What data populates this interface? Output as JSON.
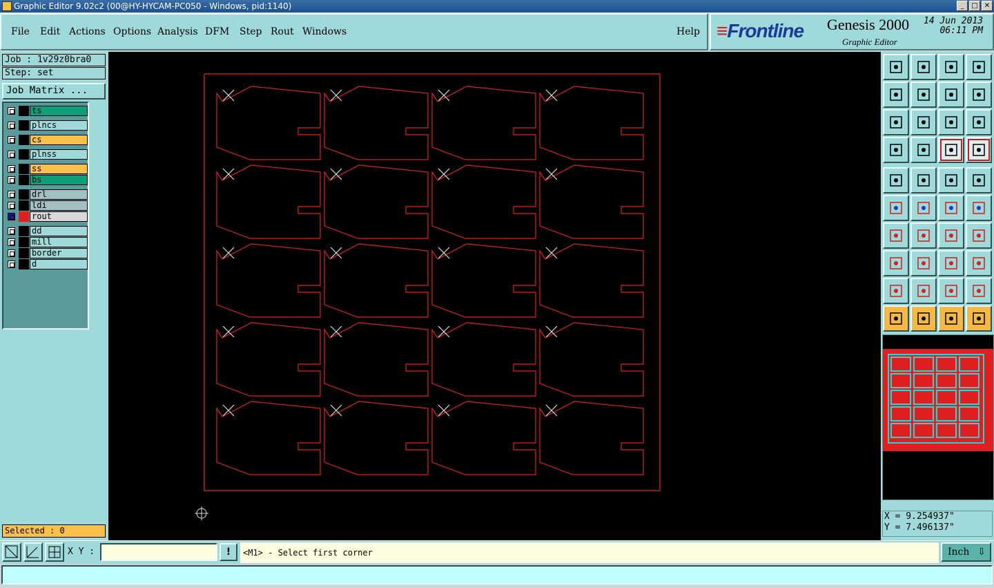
{
  "window": {
    "title": "Graphic Editor 9.02c2 (00@HY-HYCAM-PC050 - Windows, pid:1140)",
    "icon": "app-icon",
    "buttons": [
      "_",
      "□",
      "✕"
    ]
  },
  "menu": [
    "File",
    "Edit",
    "Actions",
    "Options",
    "Analysis",
    "DFM",
    "Step",
    "Rout",
    "Windows"
  ],
  "help": "Help",
  "brand": {
    "logo": "Frontline",
    "product": "Genesis 2000",
    "subtitle": "Graphic Editor",
    "date": "14 Jun 2013",
    "time": "06:11 PM"
  },
  "job": {
    "job_label": "Job : 1v29z0bra0",
    "step_label": "Step: set",
    "matrix_button": "Job Matrix ..."
  },
  "layers": [
    {
      "name": "ts",
      "color": "#0e9e7a"
    },
    {
      "name": "plncs",
      "color": "#9fd9d9"
    },
    {
      "name": "cs",
      "color": "#f9c14a"
    },
    {
      "name": "plnss",
      "color": "#9fd9d9"
    },
    {
      "name": "ss",
      "color": "#f9c14a"
    },
    {
      "name": "bs",
      "color": "#0e9e7a"
    },
    {
      "name": "drl",
      "color": "#a3bfc4"
    },
    {
      "name": "ldi",
      "color": "#a3bfc4"
    },
    {
      "name": "rout",
      "color": "#d8d8d8",
      "active": true
    },
    {
      "name": "dd",
      "color": "#9fd9d9"
    },
    {
      "name": "mill",
      "color": "#9fd9d9"
    },
    {
      "name": "border",
      "color": "#9fd9d9"
    },
    {
      "name": "d",
      "color": "#9fd9d9"
    }
  ],
  "selected": "Selected : 0",
  "coords": {
    "x": "X = 9.254937\"",
    "y": "Y = 7.496137\""
  },
  "xy_label": "X Y :",
  "xy_value": "",
  "prompt": "<M1> - Select first corner",
  "unit": "Inch",
  "exclaim": "!",
  "colors": {
    "rout": "#e02020",
    "bg": "#000000",
    "panel": "#9fd9d9"
  }
}
